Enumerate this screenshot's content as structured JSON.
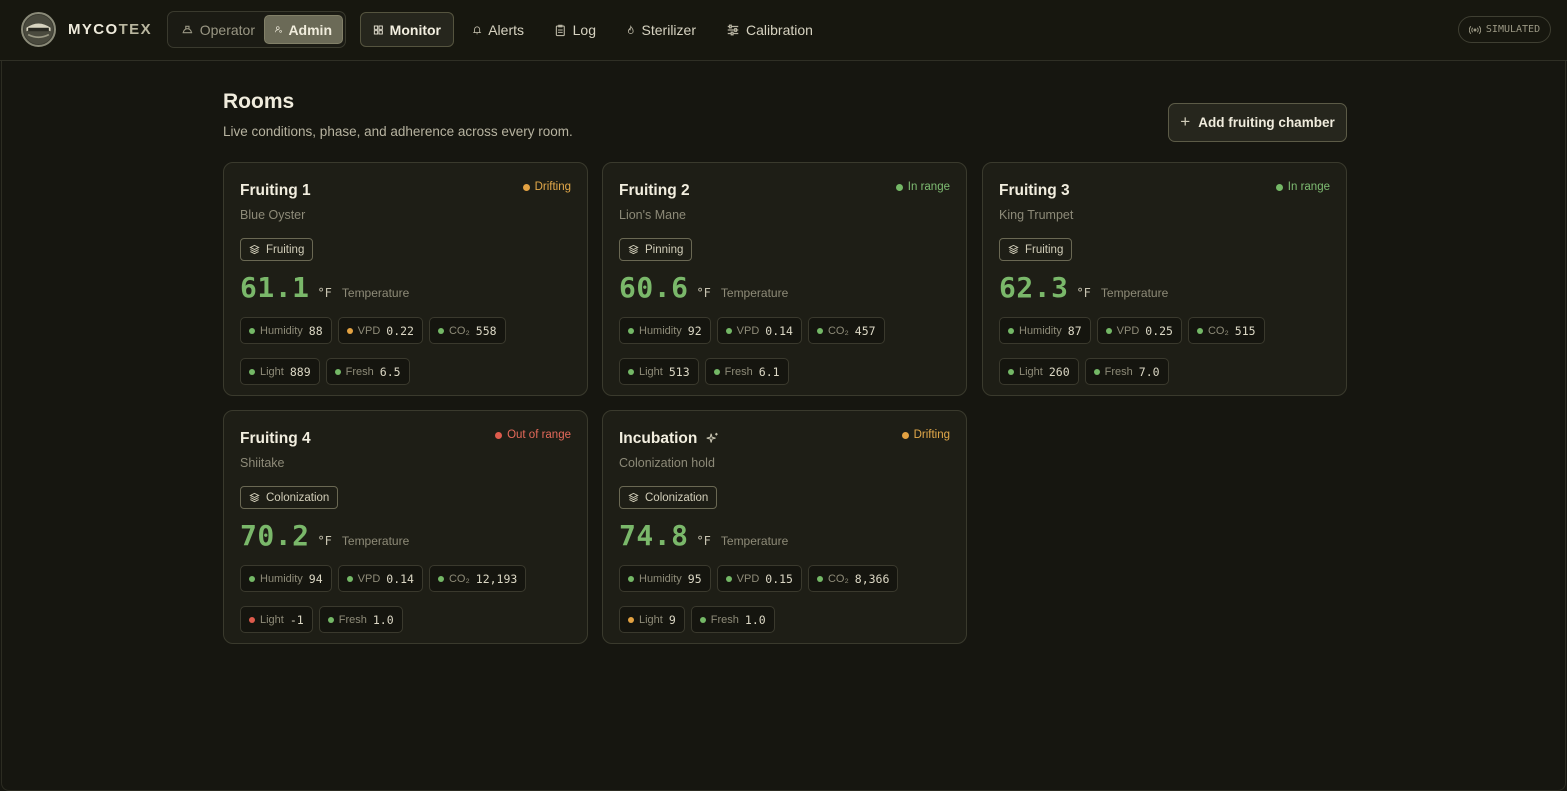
{
  "brand": {
    "name_main": "MYCO",
    "name_accent": "TEX"
  },
  "roles": {
    "operator": "Operator",
    "admin": "Admin"
  },
  "nav": {
    "monitor": "Monitor",
    "alerts": "Alerts",
    "log": "Log",
    "sterilizer": "Sterilizer",
    "calibration": "Calibration"
  },
  "mode_badge": "SIMULATED",
  "page": {
    "title": "Rooms",
    "subtitle": "Live conditions, phase, and adherence across every room.",
    "add_button": "Add fruiting chamber"
  },
  "colors": {
    "ok": "#74b866",
    "warn": "#e3a242",
    "bad": "#de5b4c",
    "accent": "#7ab86a"
  },
  "rooms": [
    {
      "name": "Fruiting 1",
      "species": "Blue Oyster",
      "status": "Drifting",
      "status_level": "warn",
      "phase": "Fruiting",
      "temp_value": "61.1",
      "temp_unit": "°F",
      "temp_label": "Temperature",
      "metrics": [
        {
          "label": "Humidity",
          "value": "88",
          "level": "ok"
        },
        {
          "label": "VPD",
          "value": "0.22",
          "level": "warn"
        },
        {
          "label": "CO₂",
          "value": "558",
          "level": "ok"
        },
        {
          "label": "Light",
          "value": "889",
          "level": "ok"
        },
        {
          "label": "Fresh",
          "value": "6.5",
          "level": "ok"
        }
      ]
    },
    {
      "name": "Fruiting 2",
      "species": "Lion's Mane",
      "status": "In range",
      "status_level": "ok",
      "phase": "Pinning",
      "temp_value": "60.6",
      "temp_unit": "°F",
      "temp_label": "Temperature",
      "metrics": [
        {
          "label": "Humidity",
          "value": "92",
          "level": "ok"
        },
        {
          "label": "VPD",
          "value": "0.14",
          "level": "ok"
        },
        {
          "label": "CO₂",
          "value": "457",
          "level": "ok"
        },
        {
          "label": "Light",
          "value": "513",
          "level": "ok"
        },
        {
          "label": "Fresh",
          "value": "6.1",
          "level": "ok"
        }
      ]
    },
    {
      "name": "Fruiting 3",
      "species": "King Trumpet",
      "status": "In range",
      "status_level": "ok",
      "phase": "Fruiting",
      "temp_value": "62.3",
      "temp_unit": "°F",
      "temp_label": "Temperature",
      "metrics": [
        {
          "label": "Humidity",
          "value": "87",
          "level": "ok"
        },
        {
          "label": "VPD",
          "value": "0.25",
          "level": "ok"
        },
        {
          "label": "CO₂",
          "value": "515",
          "level": "ok"
        },
        {
          "label": "Light",
          "value": "260",
          "level": "ok"
        },
        {
          "label": "Fresh",
          "value": "7.0",
          "level": "ok"
        }
      ]
    },
    {
      "name": "Fruiting 4",
      "species": "Shiitake",
      "status": "Out of range",
      "status_level": "bad",
      "phase": "Colonization",
      "temp_value": "70.2",
      "temp_unit": "°F",
      "temp_label": "Temperature",
      "metrics": [
        {
          "label": "Humidity",
          "value": "94",
          "level": "ok"
        },
        {
          "label": "VPD",
          "value": "0.14",
          "level": "ok"
        },
        {
          "label": "CO₂",
          "value": "12,193",
          "level": "ok"
        },
        {
          "label": "Light",
          "value": "-1",
          "level": "bad"
        },
        {
          "label": "Fresh",
          "value": "1.0",
          "level": "ok"
        }
      ]
    },
    {
      "name": "Incubation",
      "species": "Colonization hold",
      "status": "Drifting",
      "status_level": "warn",
      "phase": "Colonization",
      "temp_value": "74.8",
      "temp_unit": "°F",
      "temp_label": "Temperature",
      "metrics": [
        {
          "label": "Humidity",
          "value": "95",
          "level": "ok"
        },
        {
          "label": "VPD",
          "value": "0.15",
          "level": "ok"
        },
        {
          "label": "CO₂",
          "value": "8,366",
          "level": "ok"
        },
        {
          "label": "Light",
          "value": "9",
          "level": "warn"
        },
        {
          "label": "Fresh",
          "value": "1.0",
          "level": "ok"
        }
      ]
    }
  ]
}
